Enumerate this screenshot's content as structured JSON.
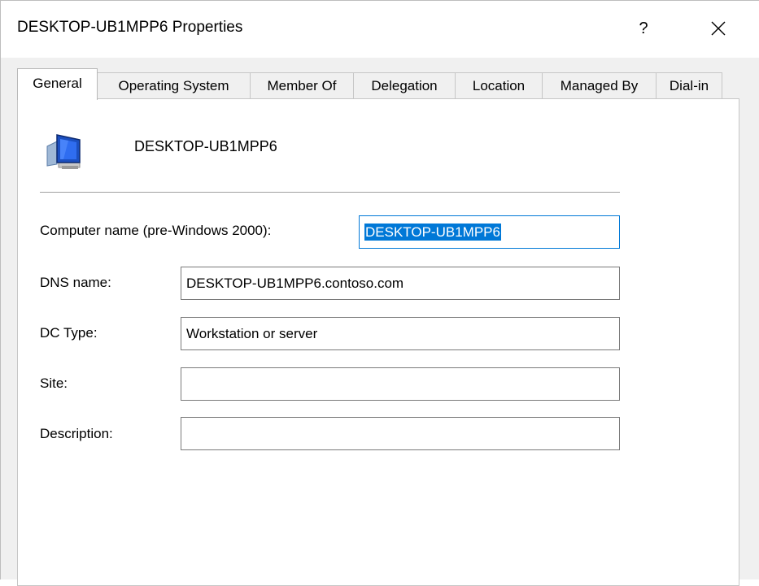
{
  "window": {
    "title": "DESKTOP-UB1MPP6 Properties",
    "help_label": "?",
    "close_icon": "close-icon"
  },
  "tabs": [
    {
      "label": "General",
      "active": true
    },
    {
      "label": "Operating System",
      "active": false
    },
    {
      "label": "Member Of",
      "active": false
    },
    {
      "label": "Delegation",
      "active": false
    },
    {
      "label": "Location",
      "active": false
    },
    {
      "label": "Managed By",
      "active": false
    },
    {
      "label": "Dial-in",
      "active": false
    }
  ],
  "general": {
    "icon": "computer-icon",
    "computer_display_name": "DESKTOP-UB1MPP6",
    "fields": {
      "pre_windows_name": {
        "label": "Computer name (pre-Windows 2000):",
        "value": "DESKTOP-UB1MPP6"
      },
      "dns_name": {
        "label": "DNS name:",
        "value": "DESKTOP-UB1MPP6.contoso.com"
      },
      "dc_type": {
        "label": "DC Type:",
        "value": "Workstation or server"
      },
      "site": {
        "label": "Site:",
        "value": ""
      },
      "description": {
        "label": "Description:",
        "value": ""
      }
    }
  },
  "colors": {
    "selection": "#0078d7",
    "panel": "#ffffff",
    "chrome": "#f0f0f0"
  }
}
